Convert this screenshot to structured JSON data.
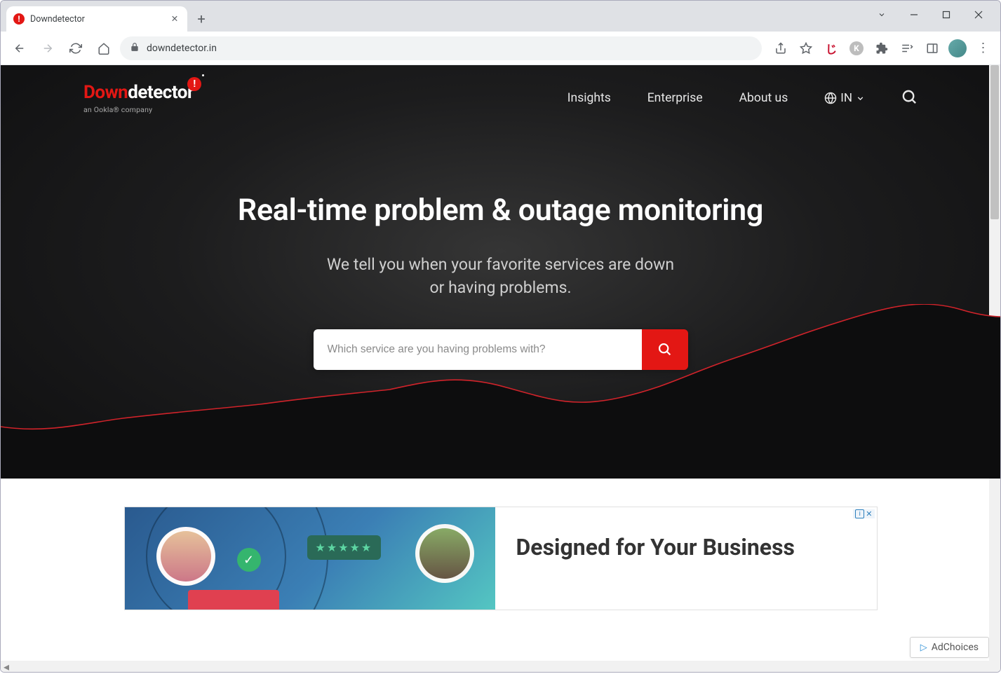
{
  "browser": {
    "tab_title": "Downdetector",
    "url": "downdetector.in"
  },
  "nav": {
    "logo_down": "Down",
    "logo_detector": "detector",
    "logo_bang": "!",
    "logo_sub": "an Ookla® company",
    "links": [
      "Insights",
      "Enterprise",
      "About us"
    ],
    "locale": "IN"
  },
  "hero": {
    "title": "Real-time problem & outage monitoring",
    "subtitle_line1": "We tell you when your favorite services are down",
    "subtitle_line2": "or having problems.",
    "search_placeholder": "Which service are you having problems with?"
  },
  "ad": {
    "heading": "Designed for Your Business",
    "close_label": "✕",
    "adchoices": "AdChoices",
    "stars": "★★★★★",
    "check": "✓"
  }
}
